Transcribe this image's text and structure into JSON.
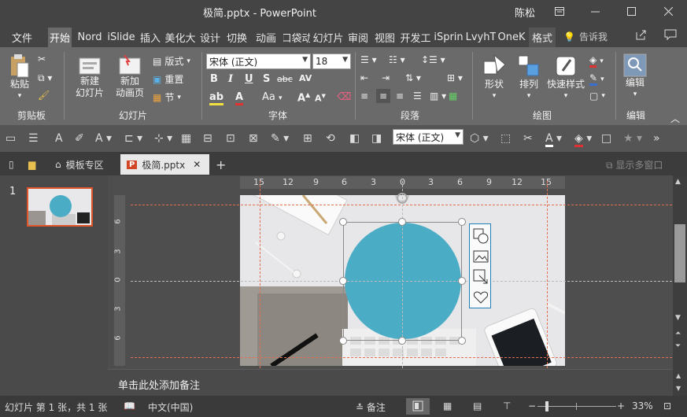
{
  "titlebar": {
    "doc_title": "极简.pptx  -  PowerPoint",
    "user": "陈松",
    "ribbon_display_icon": "ribbon-display-icon",
    "minimize_icon": "minimize-icon",
    "maximize_icon": "maximize-icon",
    "close_icon": "close-icon"
  },
  "ribbon_tabs": [
    "文件",
    "开始",
    "Nord",
    "iSlide",
    "插入",
    "美化大",
    "设计",
    "切换",
    "动画",
    "口袋动",
    "幻灯片",
    "审阅",
    "视图",
    "开发工",
    "iSprin",
    "LvyhT",
    "OneK",
    "格式"
  ],
  "active_tab": "开始",
  "tell_me": "告诉我",
  "ribbon": {
    "clipboard": {
      "label": "剪贴板",
      "paste": "粘贴"
    },
    "slides": {
      "label": "幻灯片",
      "new_slide": "新建\n幻灯片",
      "new_anim_page": "新加\n动画页",
      "layout": "版式",
      "reset": "重置",
      "section": "节"
    },
    "font": {
      "label": "字体",
      "font_name": "宋体 (正文)",
      "font_size": "18",
      "bold": "B",
      "italic": "I",
      "underline": "U",
      "shadow": "S",
      "strike": "abc",
      "spacing": "AV",
      "case": "Aa",
      "grow": "A",
      "shrink": "A"
    },
    "paragraph": {
      "label": "段落"
    },
    "drawing": {
      "label": "绘图",
      "shapes": "形状",
      "arrange": "排列",
      "quick_styles": "快速样式"
    },
    "editing": {
      "label": "编辑",
      "edit": "编辑"
    }
  },
  "quick_toolbar": {
    "font_combo": "宋体 (正文)"
  },
  "doc_tabs": {
    "template_zone": "模板专区",
    "doc_tab": "极简.pptx",
    "show_multi": "显示多窗口"
  },
  "hruler_labels": [
    "15",
    "12",
    "9",
    "6",
    "3",
    "0",
    "3",
    "6",
    "9",
    "12",
    "15"
  ],
  "vruler_labels": [
    "6",
    "3",
    "0",
    "3",
    "6"
  ],
  "slide_pane": {
    "slide_number": "1"
  },
  "notes_placeholder": "单击此处添加备注",
  "statusbar": {
    "slide_info": "幻灯片 第 1 张，共 1 张",
    "language": "中文(中国)",
    "notes": "备注",
    "zoom": "33%"
  },
  "colors": {
    "circle": "#4aacc5",
    "selection_accent": "#1e7fb8",
    "guide": "#e07050",
    "thumb_border": "#e0562a",
    "ribbon_bg": "#6a6a6a"
  }
}
